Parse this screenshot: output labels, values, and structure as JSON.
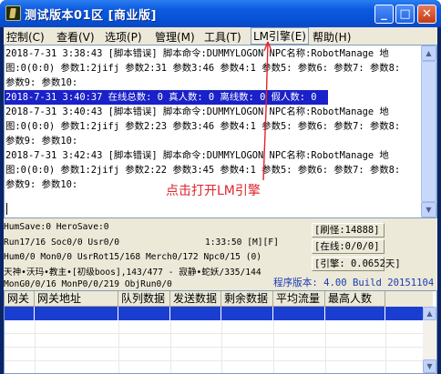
{
  "window": {
    "title": "测试版本01区 [商业版]",
    "buttons": {
      "minimize": "_",
      "maximize": "□",
      "close": "✕"
    }
  },
  "menu": {
    "items": [
      {
        "label": "控制(C)"
      },
      {
        "label": "查看(V)"
      },
      {
        "label": "选项(P)"
      },
      {
        "label": "管理(M)"
      },
      {
        "label": "工具(T)"
      },
      {
        "label": "LM引擎(E)"
      },
      {
        "label": "帮助(H)"
      }
    ]
  },
  "log": {
    "lines": [
      "2018-7-31 3:38:43 [脚本错误] 脚本命令:DUMMYLOGON NPC名称:RobotManage 地",
      "图:0(0:0) 参数1:2jifj 参数2:31 参数3:46 参数4:1 参数5: 参数6: 参数7: 参数8:",
      "参数9: 参数10:",
      "2018-7-31 3:40:37 在线总数: 0 真人数: 0 离线数: 0 假人数: 0",
      "2018-7-31 3:40:43 [脚本错误] 脚本命令:DUMMYLOGON NPC名称:RobotManage 地",
      "图:0(0:0) 参数1:2jifj 参数2:23 参数3:46 参数4:1 参数5: 参数6: 参数7: 参数8:",
      "参数9: 参数10:",
      "2018-7-31 3:42:43 [脚本错误] 脚本命令:DUMMYLOGON NPC名称:RobotManage 地",
      "图:0(0:0) 参数1:2jifj 参数2:22 参数3:45 参数4:1 参数5: 参数6: 参数7: 参数8:",
      "参数9: 参数10:"
    ],
    "highlighted_line_index": 3
  },
  "annotation": {
    "text": "点击打开LM引擎",
    "color": "#e0242c"
  },
  "status": {
    "line1": "HumSave:0 HeroSave:0",
    "line2": "Run17/16 Soc0/0 Usr0/0",
    "time": "1:33:50 [M][F]",
    "line3": "Hum0/0 Mon0/0 UsrRot15/168 Merch0/172 Npc0/15 (0)",
    "line4": "天神•沃玛•教主•[初级boos],143/477 - 寂静•蛇妖/335/144",
    "line5": "MonG0/0/16 MonP0/0/219 ObjRun0/0",
    "brush": "[刷怪:14888]",
    "online": "[在线:0/0/0]",
    "engine": "[引擎: 0.0652天]",
    "version": "程序版本: 4.00 Build 20151104"
  },
  "gateway_table": {
    "columns": [
      "网关",
      "网关地址",
      "队列数据",
      "发送数据",
      "剩余数据",
      "平均流量",
      "最高人数"
    ]
  },
  "colors": {
    "titlebar": "#0d5ae0",
    "highlight": "#1a21c8",
    "version_text": "#1b3cb5",
    "selected_row": "#1a3fd0"
  }
}
